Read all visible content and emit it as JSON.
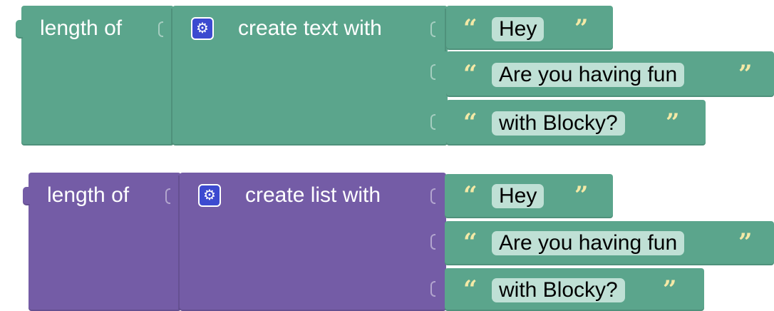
{
  "text_length_block": {
    "length_label": "length of",
    "create_label": "create text with",
    "items": [
      "Hey",
      "Are you having fun",
      "with Blocky?"
    ],
    "color": "#5ba58c"
  },
  "list_length_block": {
    "length_label": "length of",
    "create_label": "create list with",
    "items": [
      "Hey",
      "Are you having fun",
      "with Blocky?"
    ],
    "color": "#745ca6"
  },
  "text_item_color": "#5ba58c",
  "open_quote": "“",
  "close_quote": "”",
  "mutator_icon": "gear-icon"
}
